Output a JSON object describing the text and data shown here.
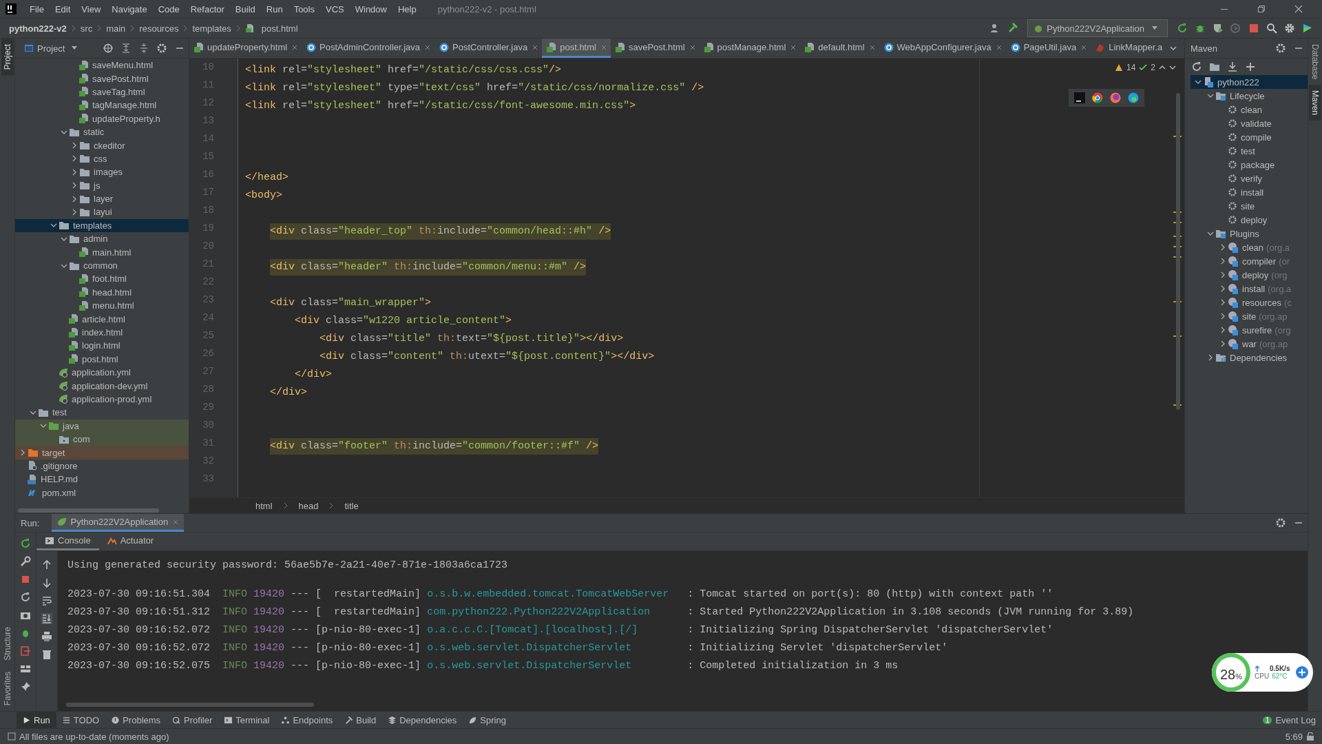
{
  "menu": [
    "File",
    "Edit",
    "View",
    "Navigate",
    "Code",
    "Refactor",
    "Build",
    "Run",
    "Tools",
    "VCS",
    "Window",
    "Help"
  ],
  "window": {
    "title": "python222-v2 - post.html"
  },
  "breadcrumb": [
    "python222-v2",
    "src",
    "main",
    "resources",
    "templates",
    "post.html"
  ],
  "run_config": "Python222V2Application",
  "left_strip": [
    "Project",
    "Structure",
    "Favorites"
  ],
  "right_strip": [
    "Database",
    "Maven"
  ],
  "project": {
    "title": "Project",
    "tree": [
      {
        "children": [
          {
            "children": [
              {
                "children": [
                  {
                    "children": [
                      {
                        "children": [
                          {
                            "label": "saveMenu.html",
                            "kind": "html",
                            "selected": false
                          },
                          {
                            "label": "savePost.html",
                            "kind": "html",
                            "selected": false
                          },
                          {
                            "label": "saveTag.html",
                            "kind": "html",
                            "selected": false
                          },
                          {
                            "label": "tagManage.html",
                            "kind": "html",
                            "selected": false
                          },
                          {
                            "label": "updateProperty.h",
                            "kind": "html",
                            "selected": false
                          }
                        ]
                      },
                      {
                        "label": "static",
                        "kind": "folder",
                        "expanded": true,
                        "selected": false,
                        "children": [
                          {
                            "label": "ckeditor",
                            "kind": "folder",
                            "expanded": false,
                            "selected": false
                          },
                          {
                            "label": "css",
                            "kind": "folder",
                            "expanded": false,
                            "selected": false
                          },
                          {
                            "label": "images",
                            "kind": "folder",
                            "expanded": false,
                            "selected": false
                          },
                          {
                            "label": "js",
                            "kind": "folder",
                            "expanded": false,
                            "selected": false
                          },
                          {
                            "label": "layer",
                            "kind": "folder",
                            "expanded": false,
                            "selected": false
                          },
                          {
                            "label": "layui",
                            "kind": "folder",
                            "expanded": false,
                            "selected": false
                          }
                        ]
                      }
                    ]
                  },
                  {
                    "label": "templates",
                    "kind": "folder",
                    "expanded": true,
                    "selected": true,
                    "children": [
                      {
                        "label": "admin",
                        "kind": "folder",
                        "expanded": true,
                        "selected": false,
                        "children": [
                          {
                            "label": "main.html",
                            "kind": "html",
                            "selected": false
                          }
                        ]
                      },
                      {
                        "label": "common",
                        "kind": "folder",
                        "expanded": true,
                        "selected": false,
                        "children": [
                          {
                            "label": "foot.html",
                            "kind": "html",
                            "selected": false
                          },
                          {
                            "label": "head.html",
                            "kind": "html",
                            "selected": false
                          },
                          {
                            "label": "menu.html",
                            "kind": "html",
                            "selected": false
                          }
                        ]
                      },
                      {
                        "label": "article.html",
                        "kind": "html",
                        "selected": false
                      },
                      {
                        "label": "index.html",
                        "kind": "html",
                        "selected": false
                      },
                      {
                        "label": "login.html",
                        "kind": "html",
                        "selected": false
                      },
                      {
                        "label": "post.html",
                        "kind": "html",
                        "selected": false
                      }
                    ]
                  },
                  {
                    "label": "application.yml",
                    "kind": "yml",
                    "selected": false
                  },
                  {
                    "label": "application-dev.yml",
                    "kind": "yml",
                    "selected": false
                  },
                  {
                    "label": "application-prod.yml",
                    "kind": "yml",
                    "selected": false
                  }
                ]
              }
            ]
          },
          {
            "label": "test",
            "kind": "folder",
            "expanded": true,
            "selected": false,
            "children": [
              {
                "label": "java",
                "kind": "test-folder",
                "expanded": true,
                "selected": false,
                "children": [
                  {
                    "label": "com",
                    "kind": "test-package",
                    "selected": false
                  }
                ]
              }
            ]
          }
        ]
      },
      {
        "label": "target",
        "kind": "excluded-folder",
        "expanded": false,
        "selected": false
      },
      {
        "label": ".gitignore",
        "kind": "ignore",
        "selected": false
      },
      {
        "label": "HELP.md",
        "kind": "md",
        "selected": false
      },
      {
        "label": "pom.xml",
        "kind": "pom",
        "selected": false
      }
    ]
  },
  "tabs": [
    {
      "label": "updateProperty.html",
      "kind": "html",
      "selected": false,
      "closable": true
    },
    {
      "label": "PostAdminController.java",
      "kind": "java",
      "selected": false,
      "closable": true
    },
    {
      "label": "PostController.java",
      "kind": "java",
      "selected": false,
      "closable": true
    },
    {
      "label": "post.html",
      "kind": "html",
      "selected": true,
      "closable": true
    },
    {
      "label": "savePost.html",
      "kind": "html",
      "selected": false,
      "closable": true
    },
    {
      "label": "postManage.html",
      "kind": "html",
      "selected": false,
      "closable": true
    },
    {
      "label": "default.html",
      "kind": "html",
      "selected": false,
      "closable": true
    },
    {
      "label": "WebAppConfigurer.java",
      "kind": "java",
      "selected": false,
      "closable": true
    },
    {
      "label": "PageUtil.java",
      "kind": "java",
      "selected": false,
      "closable": true
    },
    {
      "label": "LinkMapper.a",
      "kind": "mapper",
      "selected": false,
      "closable": false
    }
  ],
  "inspections": {
    "warnings": "14",
    "ok": "2"
  },
  "code": [
    {
      "n": "10",
      "highlight": false,
      "tokens": [
        {
          "kind": "tag",
          "text": "<link "
        },
        {
          "kind": "attr",
          "text": "rel="
        },
        {
          "kind": "val",
          "text": "\"stylesheet\" "
        },
        {
          "kind": "attr",
          "text": "href="
        },
        {
          "kind": "val",
          "text": "\"/static/css/css.css\""
        },
        {
          "kind": "tag",
          "text": "/>"
        }
      ]
    },
    {
      "n": "11",
      "highlight": false,
      "tokens": [
        {
          "kind": "tag",
          "text": "<link "
        },
        {
          "kind": "attr",
          "text": "rel="
        },
        {
          "kind": "val",
          "text": "\"stylesheet\" "
        },
        {
          "kind": "attr",
          "text": "type="
        },
        {
          "kind": "val",
          "text": "\"text/css\" "
        },
        {
          "kind": "attr",
          "text": "href="
        },
        {
          "kind": "val",
          "text": "\"/static/css/normalize.css\" "
        },
        {
          "kind": "tag",
          "text": "/>"
        }
      ]
    },
    {
      "n": "12",
      "highlight": false,
      "tokens": [
        {
          "kind": "tag",
          "text": "<link "
        },
        {
          "kind": "attr",
          "text": "rel="
        },
        {
          "kind": "val",
          "text": "\"stylesheet\" "
        },
        {
          "kind": "attr",
          "text": "href="
        },
        {
          "kind": "val",
          "text": "\"/static/css/font-awesome.min.css\""
        },
        {
          "kind": "tag",
          "text": ">"
        }
      ]
    },
    {
      "n": "13"
    },
    {
      "n": "14"
    },
    {
      "n": "15"
    },
    {
      "n": "16",
      "highlight": false,
      "tokens": [
        {
          "kind": "tag",
          "text": "</head>"
        }
      ]
    },
    {
      "n": "17",
      "highlight": false,
      "tokens": [
        {
          "kind": "tag",
          "text": "<body>"
        }
      ],
      "children": [
        {
          "n": "18"
        },
        {
          "n": "19",
          "highlight": true,
          "tokens": [
            {
              "kind": "tag",
              "text": "<div "
            },
            {
              "kind": "attr",
              "text": "class="
            },
            {
              "kind": "val",
              "text": "\"header_top\" "
            },
            {
              "kind": "ns",
              "text": "th:"
            },
            {
              "kind": "attr",
              "text": "include="
            },
            {
              "kind": "val",
              "text": "\"common/head::#h\" "
            },
            {
              "kind": "tag",
              "text": "/>"
            }
          ]
        },
        {
          "n": "20"
        },
        {
          "n": "21",
          "highlight": true,
          "tokens": [
            {
              "kind": "tag",
              "text": "<div "
            },
            {
              "kind": "attr",
              "text": "class="
            },
            {
              "kind": "val",
              "text": "\"header\" "
            },
            {
              "kind": "ns",
              "text": "th:"
            },
            {
              "kind": "attr",
              "text": "include="
            },
            {
              "kind": "val",
              "text": "\"common/menu::#m\" "
            },
            {
              "kind": "tag",
              "text": "/>"
            }
          ]
        },
        {
          "n": "22"
        },
        {
          "n": "23",
          "highlight": false,
          "tokens": [
            {
              "kind": "tag",
              "text": "<div "
            },
            {
              "kind": "attr",
              "text": "class="
            },
            {
              "kind": "val",
              "text": "\"main_wrapper\""
            },
            {
              "kind": "tag",
              "text": ">"
            }
          ],
          "children": [
            {
              "n": "24",
              "highlight": false,
              "tokens": [
                {
                  "kind": "tag",
                  "text": "<div "
                },
                {
                  "kind": "attr",
                  "text": "class="
                },
                {
                  "kind": "val",
                  "text": "\"w1220 article_content\""
                },
                {
                  "kind": "tag",
                  "text": ">"
                }
              ],
              "children": [
                {
                  "n": "25",
                  "highlight": false,
                  "tokens": [
                    {
                      "kind": "tag",
                      "text": "<div "
                    },
                    {
                      "kind": "attr",
                      "text": "class="
                    },
                    {
                      "kind": "val",
                      "text": "\"title\" "
                    },
                    {
                      "kind": "ns",
                      "text": "th:"
                    },
                    {
                      "kind": "attr",
                      "text": "text="
                    },
                    {
                      "kind": "val",
                      "text": "\"${post.title}\""
                    },
                    {
                      "kind": "tag",
                      "text": "></div>"
                    }
                  ]
                },
                {
                  "n": "26",
                  "highlight": false,
                  "tokens": [
                    {
                      "kind": "tag",
                      "text": "<div "
                    },
                    {
                      "kind": "attr",
                      "text": "class="
                    },
                    {
                      "kind": "val",
                      "text": "\"content\" "
                    },
                    {
                      "kind": "ns",
                      "text": "th:"
                    },
                    {
                      "kind": "attr",
                      "text": "utext="
                    },
                    {
                      "kind": "val",
                      "text": "\"${post.content}\""
                    },
                    {
                      "kind": "tag",
                      "text": "></div>"
                    }
                  ]
                }
              ]
            },
            {
              "n": "27",
              "highlight": false,
              "tokens": [
                {
                  "kind": "tag",
                  "text": "</div>"
                }
              ]
            }
          ]
        },
        {
          "n": "28",
          "highlight": false,
          "tokens": [
            {
              "kind": "tag",
              "text": "</div>"
            }
          ]
        },
        {
          "n": "29"
        },
        {
          "n": "30"
        },
        {
          "n": "31",
          "highlight": true,
          "tokens": [
            {
              "kind": "tag",
              "text": "<div "
            },
            {
              "kind": "attr",
              "text": "class="
            },
            {
              "kind": "val",
              "text": "\"footer\" "
            },
            {
              "kind": "ns",
              "text": "th:"
            },
            {
              "kind": "attr",
              "text": "include="
            },
            {
              "kind": "val",
              "text": "\"common/footer::#f\" "
            },
            {
              "kind": "tag",
              "text": "/>"
            }
          ]
        }
      ]
    },
    {
      "n": "32"
    },
    {
      "n": "33"
    }
  ],
  "editor_breadcrumb": [
    "html",
    "head",
    "title"
  ],
  "maven": {
    "title": "Maven",
    "tree": [
      {
        "label": "python222",
        "kind": "project",
        "expanded": true,
        "selected": true,
        "children": [
          {
            "label": "Lifecycle",
            "kind": "group",
            "expanded": true,
            "selected": false,
            "children": [
              {
                "label": "clean",
                "kind": "goal",
                "selected": false
              },
              {
                "label": "validate",
                "kind": "goal",
                "selected": false
              },
              {
                "label": "compile",
                "kind": "goal",
                "selected": false
              },
              {
                "label": "test",
                "kind": "goal",
                "selected": false
              },
              {
                "label": "package",
                "kind": "goal",
                "selected": false
              },
              {
                "label": "verify",
                "kind": "goal",
                "selected": false
              },
              {
                "label": "install",
                "kind": "goal",
                "selected": false
              },
              {
                "label": "site",
                "kind": "goal",
                "selected": false
              },
              {
                "label": "deploy",
                "kind": "goal",
                "selected": false
              }
            ]
          },
          {
            "label": "Plugins",
            "kind": "group",
            "expanded": true,
            "selected": false,
            "children": [
              {
                "label": "clean",
                "suffix": "(org.a",
                "kind": "plugin",
                "expanded": false,
                "selected": false
              },
              {
                "label": "compiler",
                "suffix": "(or",
                "kind": "plugin",
                "expanded": false,
                "selected": false
              },
              {
                "label": "deploy",
                "suffix": "(org",
                "kind": "plugin",
                "expanded": false,
                "selected": false
              },
              {
                "label": "install",
                "suffix": "(org.a",
                "kind": "plugin",
                "expanded": false,
                "selected": false
              },
              {
                "label": "resources",
                "suffix": "(c",
                "kind": "plugin",
                "expanded": false,
                "selected": false
              },
              {
                "label": "site",
                "suffix": "(org.ap",
                "kind": "plugin",
                "expanded": false,
                "selected": false
              },
              {
                "label": "surefire",
                "suffix": "(org",
                "kind": "plugin",
                "expanded": false,
                "selected": false
              },
              {
                "label": "war",
                "suffix": "(org.ap",
                "kind": "plugin",
                "expanded": false,
                "selected": false
              }
            ]
          },
          {
            "label": "Dependencies",
            "kind": "deps",
            "expanded": false,
            "selected": false
          }
        ]
      }
    ]
  },
  "run": {
    "label": "Run:",
    "tab": "Python222V2Application",
    "tabs": [
      {
        "label": "Console",
        "kind": "console",
        "selected": true
      },
      {
        "label": "Actuator",
        "kind": "actuator",
        "selected": false
      }
    ],
    "password_line": "Using generated security password: 56ae5b7e-2a21-40e7-871e-1803a6ca1723",
    "logs": [
      {
        "time": "2023-07-30 09:16:51.304",
        "level": "INFO",
        "pid": "19420",
        "sep": "---",
        "thread": "[  restartedMain]",
        "logger": "o.s.b.w.embedded.tomcat.TomcatWebServer",
        "message": ": Tomcat started on port(s): 80 (http) with context path ''"
      },
      {
        "time": "2023-07-30 09:16:51.312",
        "level": "INFO",
        "pid": "19420",
        "sep": "---",
        "thread": "[  restartedMain]",
        "logger": "com.python222.Python222V2Application",
        "message": ": Started Python222V2Application in 3.108 seconds (JVM running for 3.89)"
      },
      {
        "time": "2023-07-30 09:16:52.072",
        "level": "INFO",
        "pid": "19420",
        "sep": "---",
        "thread": "[p-nio-80-exec-1]",
        "logger": "o.a.c.c.C.[Tomcat].[localhost].[/]",
        "message": ": Initializing Spring DispatcherServlet 'dispatcherServlet'"
      },
      {
        "time": "2023-07-30 09:16:52.072",
        "level": "INFO",
        "pid": "19420",
        "sep": "---",
        "thread": "[p-nio-80-exec-1]",
        "logger": "o.s.web.servlet.DispatcherServlet",
        "message": ": Initializing Servlet 'dispatcherServlet'"
      },
      {
        "time": "2023-07-30 09:16:52.075",
        "level": "INFO",
        "pid": "19420",
        "sep": "---",
        "thread": "[p-nio-80-exec-1]",
        "logger": "o.s.web.servlet.DispatcherServlet",
        "message": ": Completed initialization in 3 ms"
      }
    ]
  },
  "tool_windows": [
    {
      "label": "Run",
      "kind": "run",
      "selected": true
    },
    {
      "label": "TODO",
      "kind": "todo",
      "selected": false
    },
    {
      "label": "Problems",
      "kind": "problems",
      "selected": false
    },
    {
      "label": "Profiler",
      "kind": "profiler",
      "selected": false
    },
    {
      "label": "Terminal",
      "kind": "terminal",
      "selected": false
    },
    {
      "label": "Endpoints",
      "kind": "endpoints",
      "selected": false
    },
    {
      "label": "Build",
      "kind": "build",
      "selected": false
    },
    {
      "label": "Dependencies",
      "kind": "deps",
      "selected": false
    },
    {
      "label": "Spring",
      "kind": "spring",
      "selected": false
    }
  ],
  "event_log": {
    "label": "Event Log",
    "count": "1"
  },
  "status_bar": {
    "message": "All files are up-to-date (moments ago)",
    "position": "5:69"
  },
  "monitor": {
    "cpu_load": "28",
    "unit": "%",
    "net": "0.5K/s",
    "cpu_label": "CPU",
    "temp": "62°C"
  }
}
